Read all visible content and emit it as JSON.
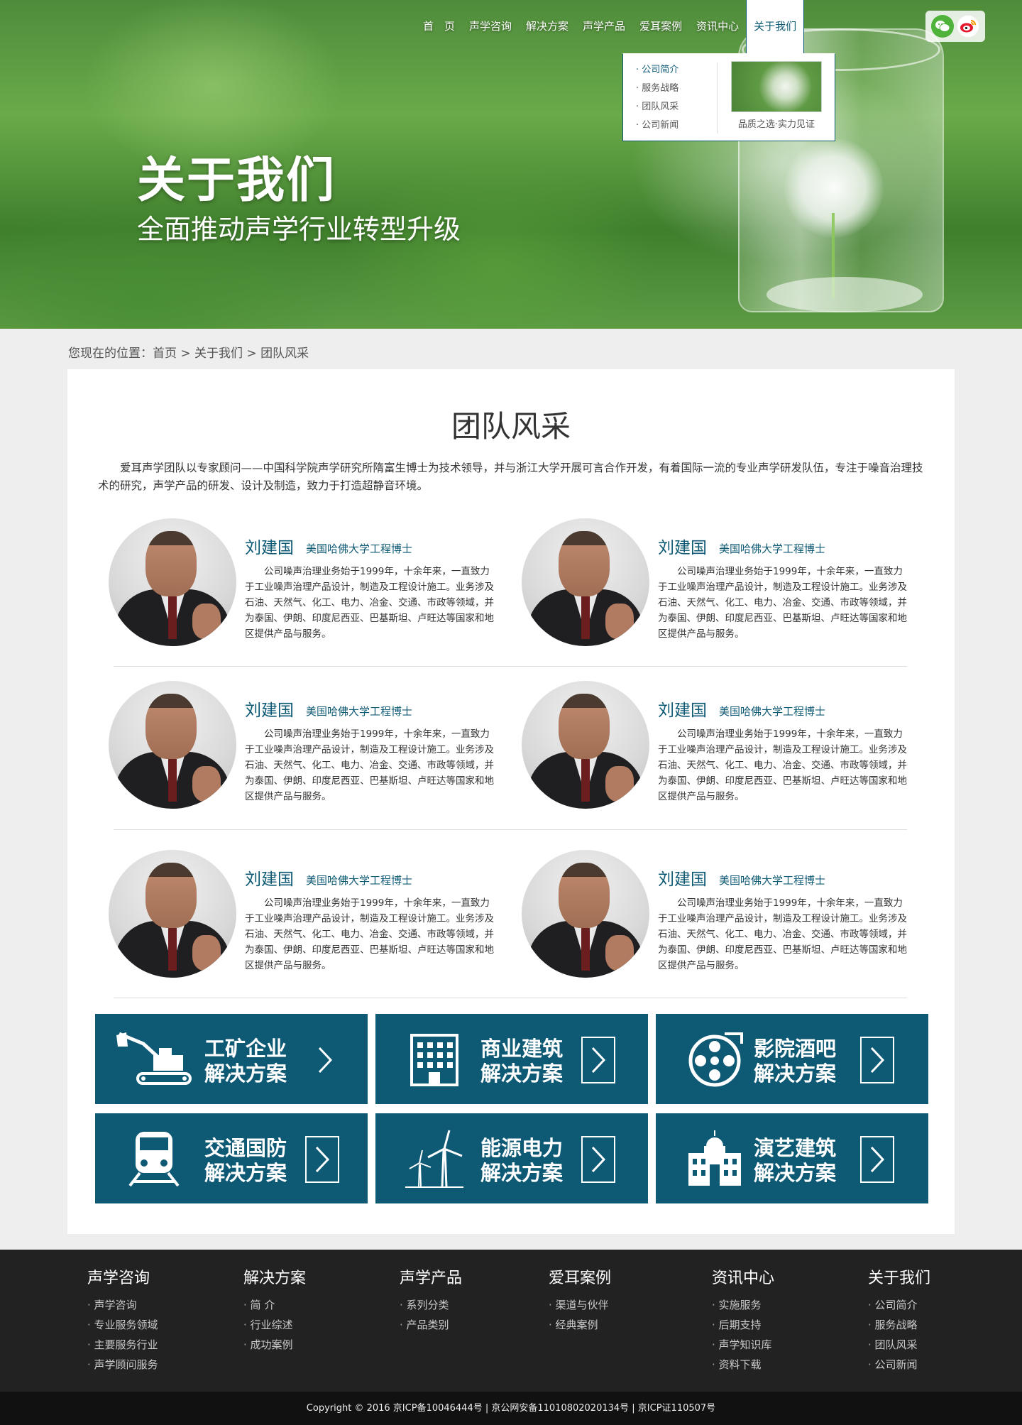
{
  "nav": {
    "items": [
      "首　页",
      "声学咨询",
      "解决方案",
      "声学产品",
      "爱耳案例",
      "资讯中心",
      "关于我们"
    ],
    "active_index": 6
  },
  "dropdown": {
    "links": [
      "公司简介",
      "服务战略",
      "团队风采",
      "公司新闻"
    ],
    "current_index": 0,
    "thumb_caption": "品质之选·实力见证"
  },
  "social": {
    "icons": [
      "wechat-icon",
      "weibo-icon"
    ]
  },
  "hero": {
    "title": "关于我们",
    "subtitle": "全面推动声学行业转型升级"
  },
  "breadcrumb": {
    "text": "您现在的位置：首页 > 关于我们 > 团队风采"
  },
  "page": {
    "title": "团队风采",
    "intro": "爱耳声学团队以专家顾问——中国科学院声学研究所隋富生博士为技术领导，并与浙江大学开展可言合作开发，有着国际一流的专业声学研发队伍，专注于噪音治理技术的研究，声学产品的研发、设计及制造，致力于打造超静音环境。"
  },
  "members": [
    {
      "name": "刘建国",
      "title": "美国哈佛大学工程博士",
      "desc": "公司噪声治理业务始于1999年，十余年来，一直致力于工业噪声治理产品设计，制造及工程设计施工。业务涉及石油、天然气、化工、电力、冶金、交通、市政等领域，并为泰国、伊朗、印度尼西亚、巴基斯坦、卢旺达等国家和地区提供产品与服务。"
    },
    {
      "name": "刘建国",
      "title": "美国哈佛大学工程博士",
      "desc": "公司噪声治理业务始于1999年，十余年来，一直致力于工业噪声治理产品设计，制造及工程设计施工。业务涉及石油、天然气、化工、电力、冶金、交通、市政等领域，并为泰国、伊朗、印度尼西亚、巴基斯坦、卢旺达等国家和地区提供产品与服务。"
    },
    {
      "name": "刘建国",
      "title": "美国哈佛大学工程博士",
      "desc": "公司噪声治理业务始于1999年，十余年来，一直致力于工业噪声治理产品设计，制造及工程设计施工。业务涉及石油、天然气、化工、电力、冶金、交通、市政等领域，并为泰国、伊朗、印度尼西亚、巴基斯坦、卢旺达等国家和地区提供产品与服务。"
    },
    {
      "name": "刘建国",
      "title": "美国哈佛大学工程博士",
      "desc": "公司噪声治理业务始于1999年，十余年来，一直致力于工业噪声治理产品设计，制造及工程设计施工。业务涉及石油、天然气、化工、电力、冶金、交通、市政等领域，并为泰国、伊朗、印度尼西亚、巴基斯坦、卢旺达等国家和地区提供产品与服务。"
    },
    {
      "name": "刘建国",
      "title": "美国哈佛大学工程博士",
      "desc": "公司噪声治理业务始于1999年，十余年来，一直致力于工业噪声治理产品设计，制造及工程设计施工。业务涉及石油、天然气、化工、电力、冶金、交通、市政等领域，并为泰国、伊朗、印度尼西亚、巴基斯坦、卢旺达等国家和地区提供产品与服务。"
    },
    {
      "name": "刘建国",
      "title": "美国哈佛大学工程博士",
      "desc": "公司噪声治理业务始于1999年，十余年来，一直致力于工业噪声治理产品设计，制造及工程设计施工。业务涉及石油、天然气、化工、电力、冶金、交通、市政等领域，并为泰国、伊朗、印度尼西亚、巴基斯坦、卢旺达等国家和地区提供产品与服务。"
    }
  ],
  "solutions": [
    {
      "line1": "工矿企业",
      "line2": "解决方案",
      "icon": "excavator-icon"
    },
    {
      "line1": "商业建筑",
      "line2": "解决方案",
      "icon": "building-icon"
    },
    {
      "line1": "影院酒吧",
      "line2": "解决方案",
      "icon": "film-reel-icon"
    },
    {
      "line1": "交通国防",
      "line2": "解决方案",
      "icon": "train-icon"
    },
    {
      "line1": "能源电力",
      "line2": "解决方案",
      "icon": "wind-turbine-icon"
    },
    {
      "line1": "演艺建筑",
      "line2": "解决方案",
      "icon": "theater-icon"
    }
  ],
  "footer": {
    "columns": [
      {
        "title": "声学咨询",
        "links": [
          "声学咨询",
          "专业服务领域",
          "主要服务行业",
          "声学顾问服务"
        ]
      },
      {
        "title": "解决方案",
        "links": [
          "简 介",
          "行业综述",
          "成功案例"
        ]
      },
      {
        "title": "声学产品",
        "links": [
          "系列分类",
          "产品类别"
        ]
      },
      {
        "title": "爱耳案例",
        "links": [
          "渠道与伙伴",
          "经典案例"
        ]
      },
      {
        "title": "资讯中心",
        "links": [
          "实施服务",
          "后期支持",
          "声学知识库",
          "资料下载"
        ]
      },
      {
        "title": "关于我们",
        "links": [
          "公司简介",
          "服务战略",
          "团队风采",
          "公司新闻"
        ]
      }
    ],
    "copyright": "Copyright © 2016  京ICP备10046444号 | 京公网安备110108020201​34号 | 京ICP证110507号"
  },
  "colors": {
    "brand": "#0e5a75",
    "footer_bg": "#222222",
    "page_bg": "#eeeeee"
  }
}
